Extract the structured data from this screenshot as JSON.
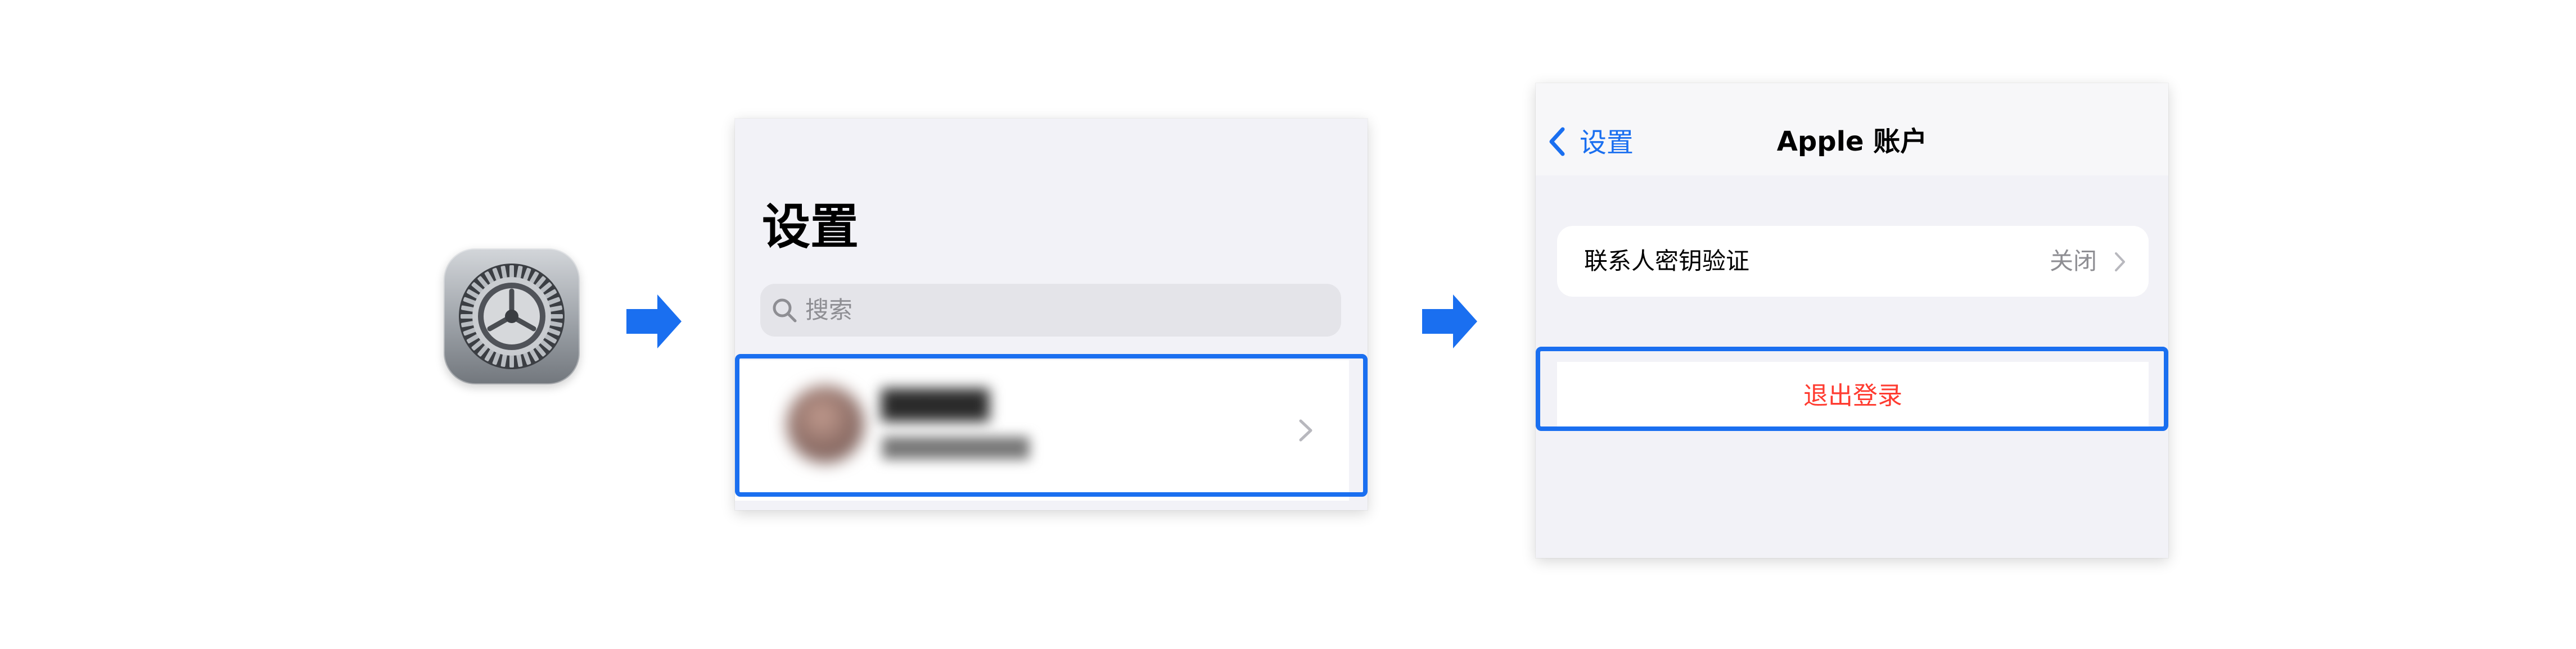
{
  "step1": {
    "icon": "settings-gear-icon"
  },
  "arrows": {
    "icon": "right-arrow-icon",
    "color": "#1a6ff0"
  },
  "step2": {
    "title": "设置",
    "search": {
      "icon": "search-icon",
      "placeholder": "搜索"
    },
    "profile_row": {
      "name": "█████",
      "subtitle": "██████████",
      "chevron_icon": "chevron-right-icon",
      "highlighted": true
    }
  },
  "step3": {
    "nav": {
      "back_label": "设置",
      "title": "Apple 账户"
    },
    "passkey_row": {
      "label": "联系人密钥验证",
      "value": "关闭"
    },
    "signout": {
      "label": "退出登录",
      "highlighted": true
    }
  },
  "colors": {
    "accent": "#1a6ff0",
    "destructive": "#ff3b30",
    "grouped_background": "#f2f2f7",
    "secondary_text": "#8e8e93"
  }
}
